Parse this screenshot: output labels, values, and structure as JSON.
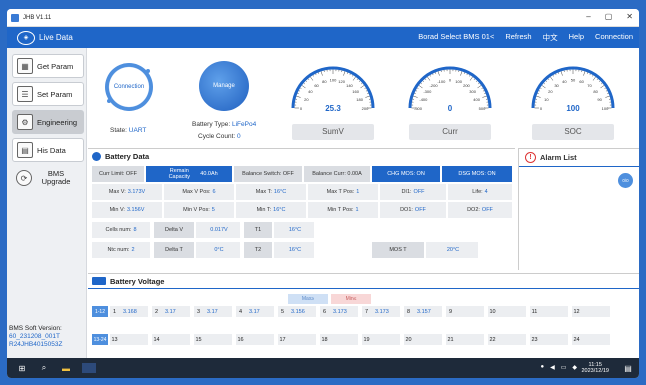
{
  "window": {
    "title": "JHB V1.11",
    "controls": [
      "–",
      "▢",
      "✕"
    ]
  },
  "topbar": {
    "logo_label": "Live Data",
    "menu": [
      "Borad Select BMS 01<",
      "Refresh",
      "中文",
      "Help",
      "Connection"
    ]
  },
  "sidebar": {
    "items": [
      {
        "label": "Get Param",
        "icon": "get-param-icon"
      },
      {
        "label": "Set Param",
        "icon": "set-param-icon"
      },
      {
        "label": "Engineering",
        "icon": "engineering-icon"
      },
      {
        "label": "His Data",
        "icon": "his-data-icon"
      },
      {
        "label": "BMS Upgrade",
        "icon": "bms-upgrade-icon"
      }
    ],
    "version_label": "BMS Soft Version:",
    "version_line1": "60_231208_001T",
    "version_line2": "R24JHB4015053Z"
  },
  "status": {
    "connection_label": "Connection",
    "manage_label": "Manage",
    "state_key": "State:",
    "state_val": "UART",
    "battery_type_key": "Battery Type:",
    "battery_type_val": "LiFePo4",
    "cycle_key": "Cycle Count:",
    "cycle_val": "0"
  },
  "gauges": [
    {
      "name": "SumV",
      "value": "25.3",
      "ticks": [
        "20",
        "40",
        "60",
        "80",
        "100",
        "120",
        "140",
        "160",
        "180"
      ],
      "min_label": "0",
      "max_label": "200"
    },
    {
      "name": "Curr",
      "value": "0",
      "ticks": [
        "-400",
        "-300",
        "-200",
        "-100",
        "0",
        "100",
        "200",
        "300",
        "400"
      ],
      "min_label": "-500",
      "max_label": "500"
    },
    {
      "name": "SOC",
      "value": "100",
      "ticks": [
        "10",
        "20",
        "30",
        "40",
        "50",
        "60",
        "70",
        "80",
        "90"
      ],
      "min_label": "0",
      "max_label": "100"
    }
  ],
  "battery_data": {
    "title": "Battery Data",
    "row1": {
      "curr_limit": "Curr Limit: OFF",
      "remain_capacity_key": "Remain Capacity",
      "remain_capacity_val": "40.0Ah",
      "balance_switch": "Balance Switch: OFF",
      "balance_curr": "Balance Curr: 0.00A",
      "chg_mos": "CHG MOS: ON",
      "dsg_mos": "DSG MOS: ON"
    },
    "row2": [
      {
        "k": "Max V:",
        "v": "3.173V"
      },
      {
        "k": "Max V Pos:",
        "v": "6"
      },
      {
        "k": "Max T:",
        "v": "16°C"
      },
      {
        "k": "Max T Pos:",
        "v": "1"
      },
      {
        "k": "DI1:",
        "v": "OFF"
      },
      {
        "k": "Life:",
        "v": "4"
      }
    ],
    "row3": [
      {
        "k": "Min V:",
        "v": "3.156V"
      },
      {
        "k": "Min V Pos:",
        "v": "5"
      },
      {
        "k": "Min T:",
        "v": "16°C"
      },
      {
        "k": "Min T Pos:",
        "v": "1"
      },
      {
        "k": "DO1:",
        "v": "OFF"
      },
      {
        "k": "DO2:",
        "v": "OFF"
      }
    ],
    "cells_num_key": "Cells num:",
    "cells_num_val": "8",
    "ntc_num_key": "Ntc num:",
    "ntc_num_val": "2",
    "delta_v_key": "Delta V",
    "delta_v_val": "0.017V",
    "delta_t_key": "Delta T",
    "delta_t_val": "0°C",
    "t1_key": "T1",
    "t1_val": "16°C",
    "t2_key": "T2",
    "t2_val": "16°C",
    "mos_t_key": "MOS T",
    "mos_t_val": "20°C"
  },
  "alarm": {
    "title": "Alarm List",
    "badge": "0\\0"
  },
  "battery_voltage": {
    "title": "Battery Voltage",
    "tag_max": "Max≥",
    "tag_min": "Min≤",
    "row1_label": "1-12",
    "row2_label": "13-24",
    "row1": [
      {
        "n": "1",
        "v": "3.168"
      },
      {
        "n": "2",
        "v": "3.17"
      },
      {
        "n": "3",
        "v": "3.17"
      },
      {
        "n": "4",
        "v": "3.17"
      },
      {
        "n": "5",
        "v": "3.156"
      },
      {
        "n": "6",
        "v": "3.173"
      },
      {
        "n": "7",
        "v": "3.173"
      },
      {
        "n": "8",
        "v": "3.157"
      },
      {
        "n": "9",
        "v": ""
      },
      {
        "n": "10",
        "v": ""
      },
      {
        "n": "11",
        "v": ""
      },
      {
        "n": "12",
        "v": ""
      }
    ],
    "row2": [
      {
        "n": "13",
        "v": ""
      },
      {
        "n": "14",
        "v": ""
      },
      {
        "n": "15",
        "v": ""
      },
      {
        "n": "16",
        "v": ""
      },
      {
        "n": "17",
        "v": ""
      },
      {
        "n": "18",
        "v": ""
      },
      {
        "n": "19",
        "v": ""
      },
      {
        "n": "20",
        "v": ""
      },
      {
        "n": "21",
        "v": ""
      },
      {
        "n": "22",
        "v": ""
      },
      {
        "n": "23",
        "v": ""
      },
      {
        "n": "24",
        "v": ""
      }
    ]
  },
  "taskbar": {
    "time": "11:15",
    "date": "2023/12/19"
  },
  "colors": {
    "accent": "#1f66c8",
    "gauge_arc": "#1f66c8",
    "alarm": "#d33333"
  }
}
